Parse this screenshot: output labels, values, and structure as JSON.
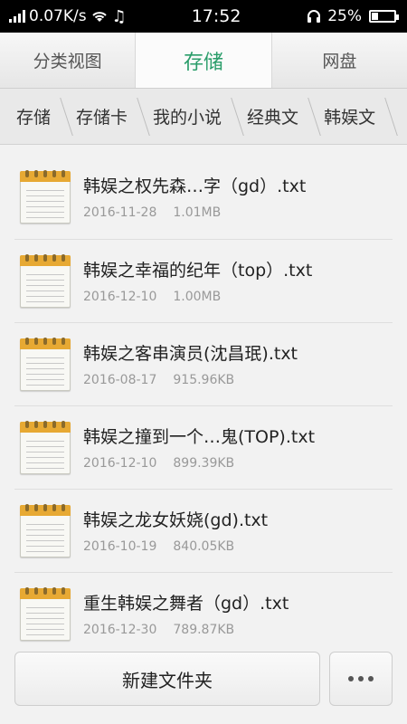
{
  "status_bar": {
    "net_speed": "0.07K/s",
    "time": "17:52",
    "battery_percent": "25%",
    "battery_level": 0.25,
    "icons": [
      "signal-icon",
      "wifi-icon",
      "music-icon",
      "headset-icon",
      "battery-icon"
    ]
  },
  "tabs": [
    {
      "label": "分类视图",
      "active": false
    },
    {
      "label": "存储",
      "active": true
    },
    {
      "label": "网盘",
      "active": false
    }
  ],
  "breadcrumb": [
    "存储",
    "存储卡",
    "我的小说",
    "经典文",
    "韩娱文"
  ],
  "files": [
    {
      "name": "韩娱之权先森…字（gd）.txt",
      "date": "2016-11-28",
      "size": "1.01MB"
    },
    {
      "name": "韩娱之幸福的纪年（top）.txt",
      "date": "2016-12-10",
      "size": "1.00MB"
    },
    {
      "name": "韩娱之客串演员(沈昌珉).txt",
      "date": "2016-08-17",
      "size": "915.96KB"
    },
    {
      "name": "韩娱之撞到一个…鬼(TOP).txt",
      "date": "2016-12-10",
      "size": "899.39KB"
    },
    {
      "name": "韩娱之龙女妖娆(gd).txt",
      "date": "2016-10-19",
      "size": "840.05KB"
    },
    {
      "name": "重生韩娱之舞者（gd）.txt",
      "date": "2016-12-30",
      "size": "789.87KB"
    }
  ],
  "bottom": {
    "new_folder_label": "新建文件夹",
    "more_icon": "more-icon"
  },
  "colors": {
    "accent": "#2a9d6a",
    "icon_top": "#e7a933"
  }
}
